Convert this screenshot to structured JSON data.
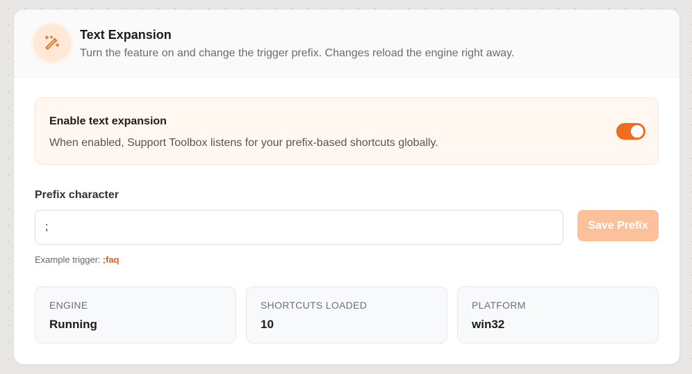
{
  "header": {
    "title": "Text Expansion",
    "subtitle": "Turn the feature on and change the trigger prefix. Changes reload the engine right away.",
    "icon": "magic-wand-icon"
  },
  "toggle": {
    "title": "Enable text expansion",
    "description": "When enabled, Support Toolbox listens for your prefix-based shortcuts globally.",
    "enabled": true
  },
  "prefix": {
    "label": "Prefix character",
    "value": ";",
    "save_label": "Save Prefix",
    "example_label": "Example trigger:",
    "example_value": ";faq"
  },
  "stats": [
    {
      "label": "ENGINE",
      "value": "Running"
    },
    {
      "label": "SHORTCUTS LOADED",
      "value": "10"
    },
    {
      "label": "PLATFORM",
      "value": "win32"
    }
  ],
  "colors": {
    "accent": "#ef6d1e",
    "accent_light": "#fcc09a",
    "panel_bg": "#fff7f0"
  }
}
